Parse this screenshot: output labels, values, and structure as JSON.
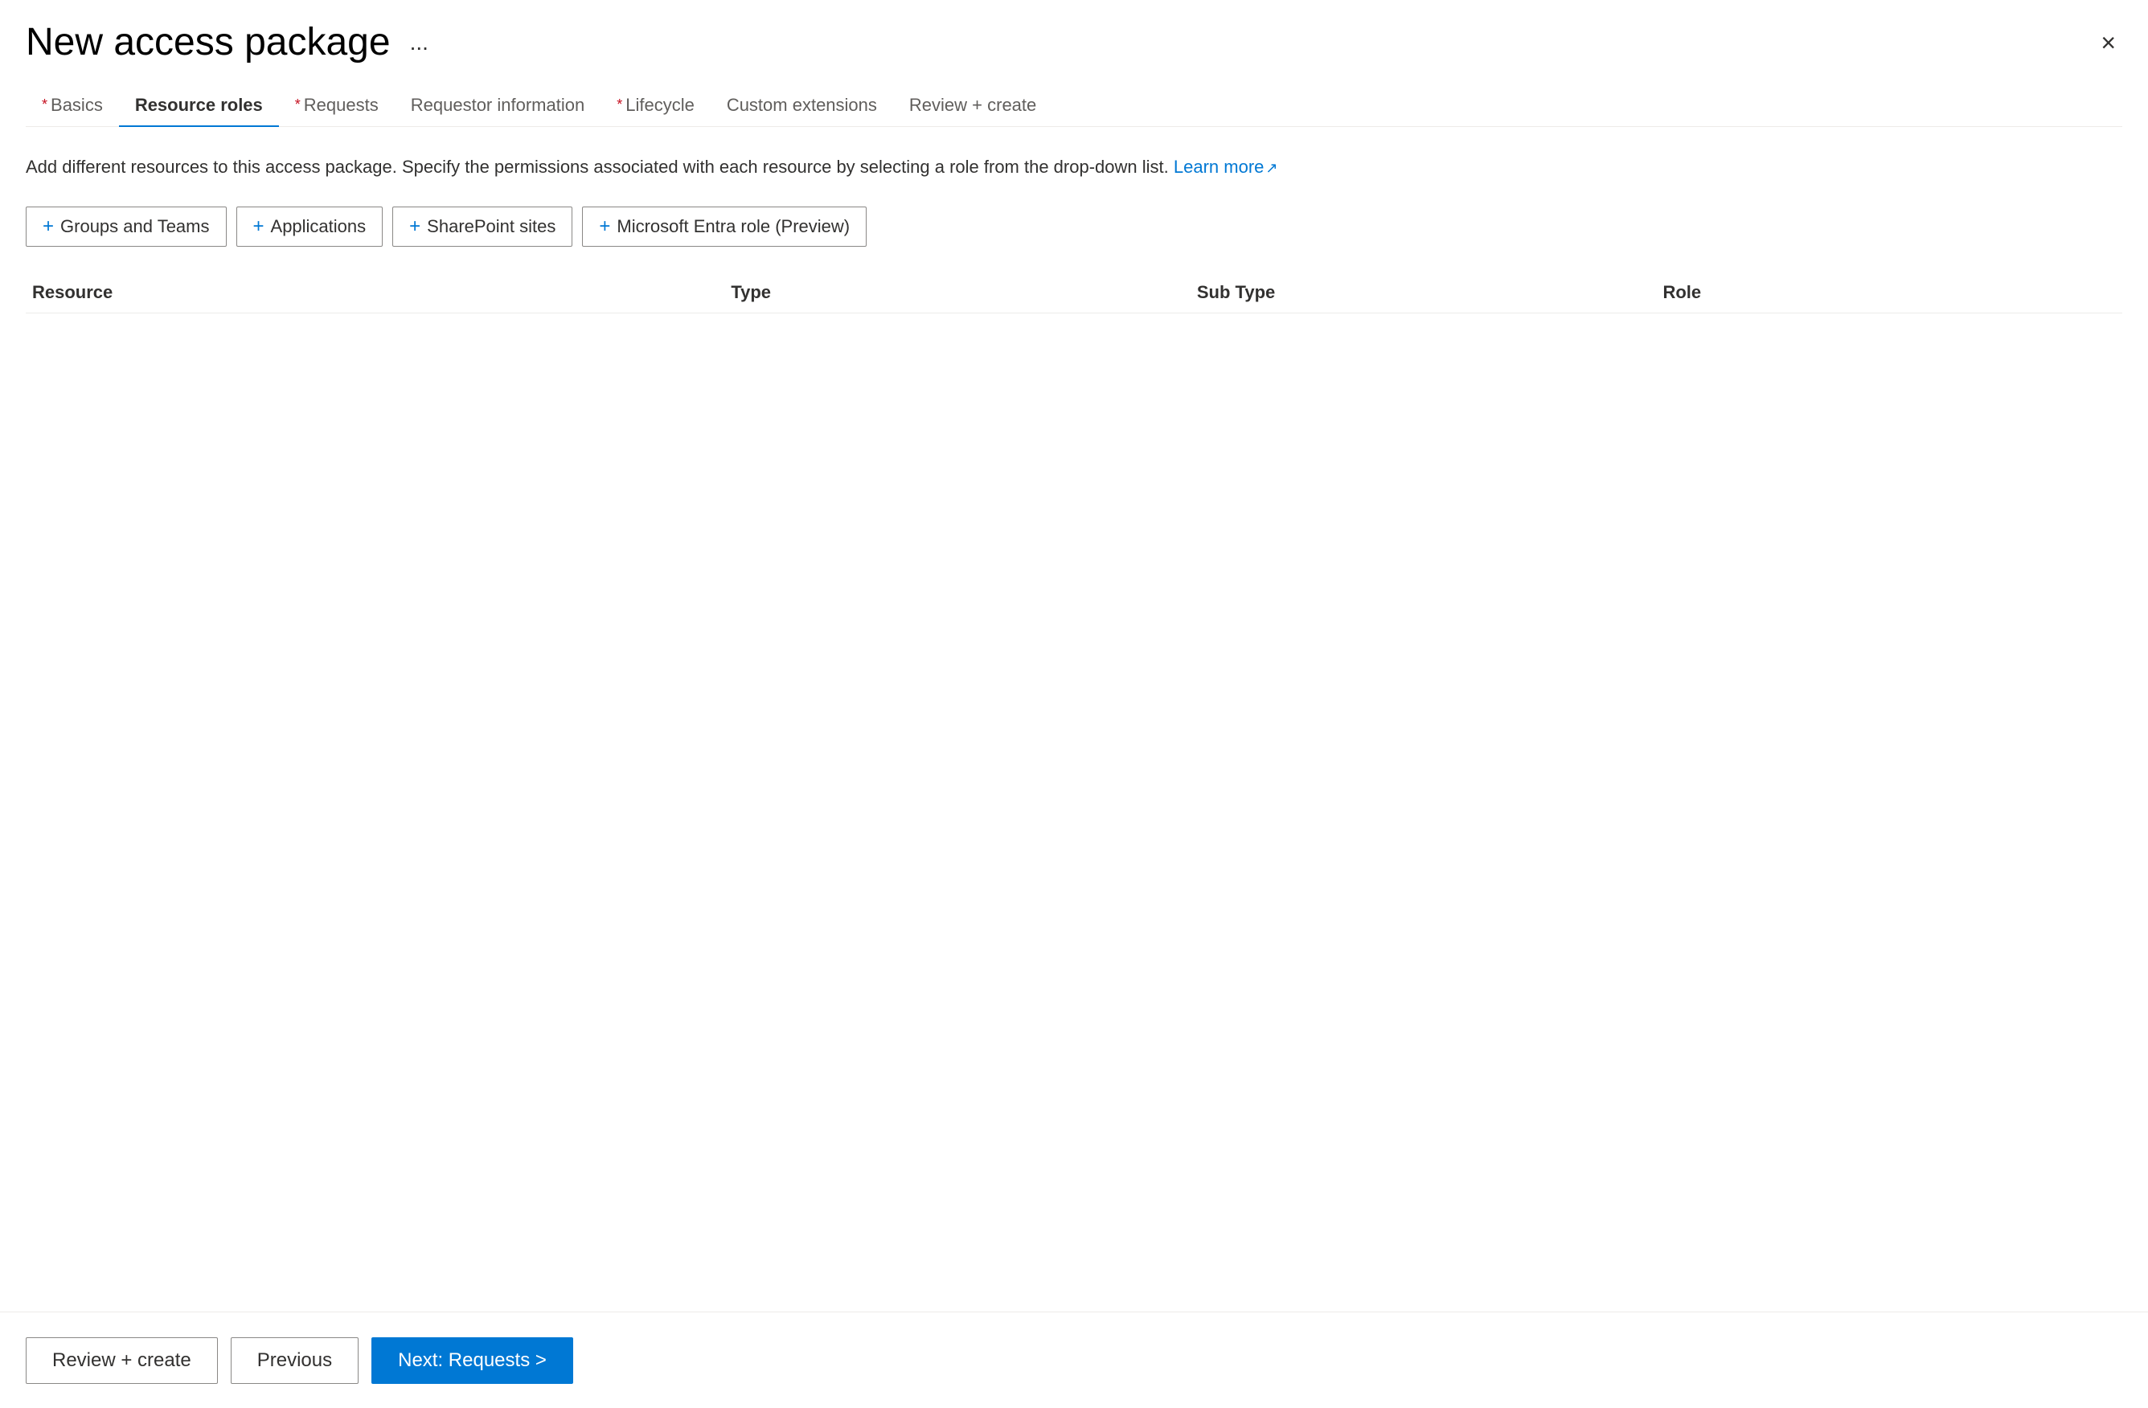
{
  "header": {
    "title": "New access package",
    "more_options_label": "...",
    "close_label": "×"
  },
  "tabs": [
    {
      "id": "basics",
      "label": "Basics",
      "required": true,
      "active": false
    },
    {
      "id": "resource-roles",
      "label": "Resource roles",
      "required": false,
      "active": true
    },
    {
      "id": "requests",
      "label": "Requests",
      "required": true,
      "active": false
    },
    {
      "id": "requestor-information",
      "label": "Requestor information",
      "required": false,
      "active": false
    },
    {
      "id": "lifecycle",
      "label": "Lifecycle",
      "required": true,
      "active": false
    },
    {
      "id": "custom-extensions",
      "label": "Custom extensions",
      "required": false,
      "active": false
    },
    {
      "id": "review-create",
      "label": "Review + create",
      "required": false,
      "active": false
    }
  ],
  "description": {
    "text": "Add different resources to this access package. Specify the permissions associated with each resource by selecting a role from the drop-down list.",
    "learn_more_label": "Learn more",
    "learn_more_icon": "↗"
  },
  "action_buttons": [
    {
      "id": "groups-and-teams",
      "label": "Groups and Teams"
    },
    {
      "id": "applications",
      "label": "Applications"
    },
    {
      "id": "sharepoint-sites",
      "label": "SharePoint sites"
    },
    {
      "id": "microsoft-entra-role",
      "label": "Microsoft Entra role (Preview)"
    }
  ],
  "table": {
    "columns": [
      {
        "id": "resource",
        "label": "Resource"
      },
      {
        "id": "type",
        "label": "Type"
      },
      {
        "id": "sub-type",
        "label": "Sub Type"
      },
      {
        "id": "role",
        "label": "Role"
      }
    ],
    "rows": []
  },
  "footer": {
    "review_create_label": "Review + create",
    "previous_label": "Previous",
    "next_label": "Next: Requests >"
  }
}
